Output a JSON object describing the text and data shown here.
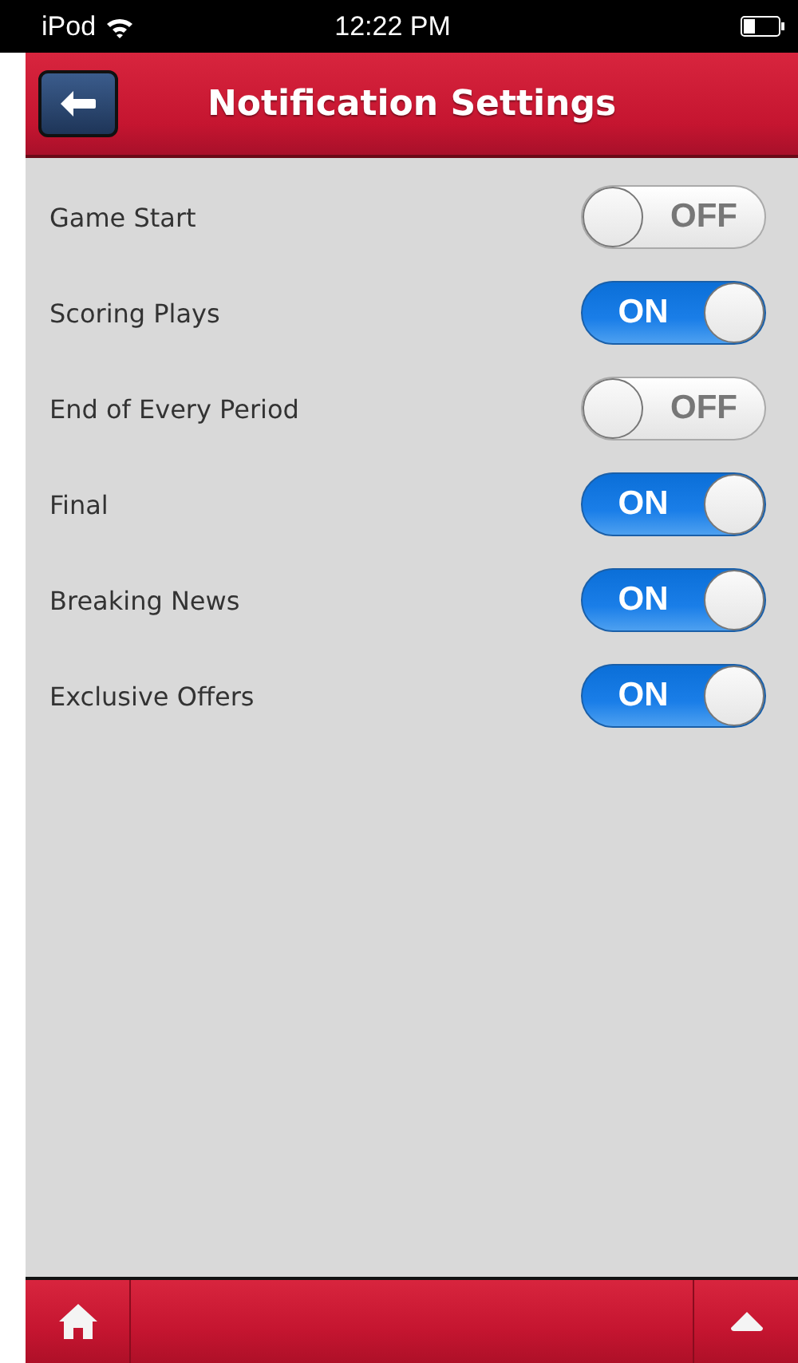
{
  "status_bar": {
    "carrier": "iPod",
    "time": "12:22 PM"
  },
  "header": {
    "title": "Notification Settings"
  },
  "settings": [
    {
      "label": "Game Start",
      "on": false,
      "toggle_text": "OFF"
    },
    {
      "label": "Scoring Plays",
      "on": true,
      "toggle_text": "ON"
    },
    {
      "label": "End of Every Period",
      "on": false,
      "toggle_text": "OFF"
    },
    {
      "label": "Final",
      "on": true,
      "toggle_text": "ON"
    },
    {
      "label": "Breaking News",
      "on": true,
      "toggle_text": "ON"
    },
    {
      "label": "Exclusive Offers",
      "on": true,
      "toggle_text": "ON"
    }
  ]
}
